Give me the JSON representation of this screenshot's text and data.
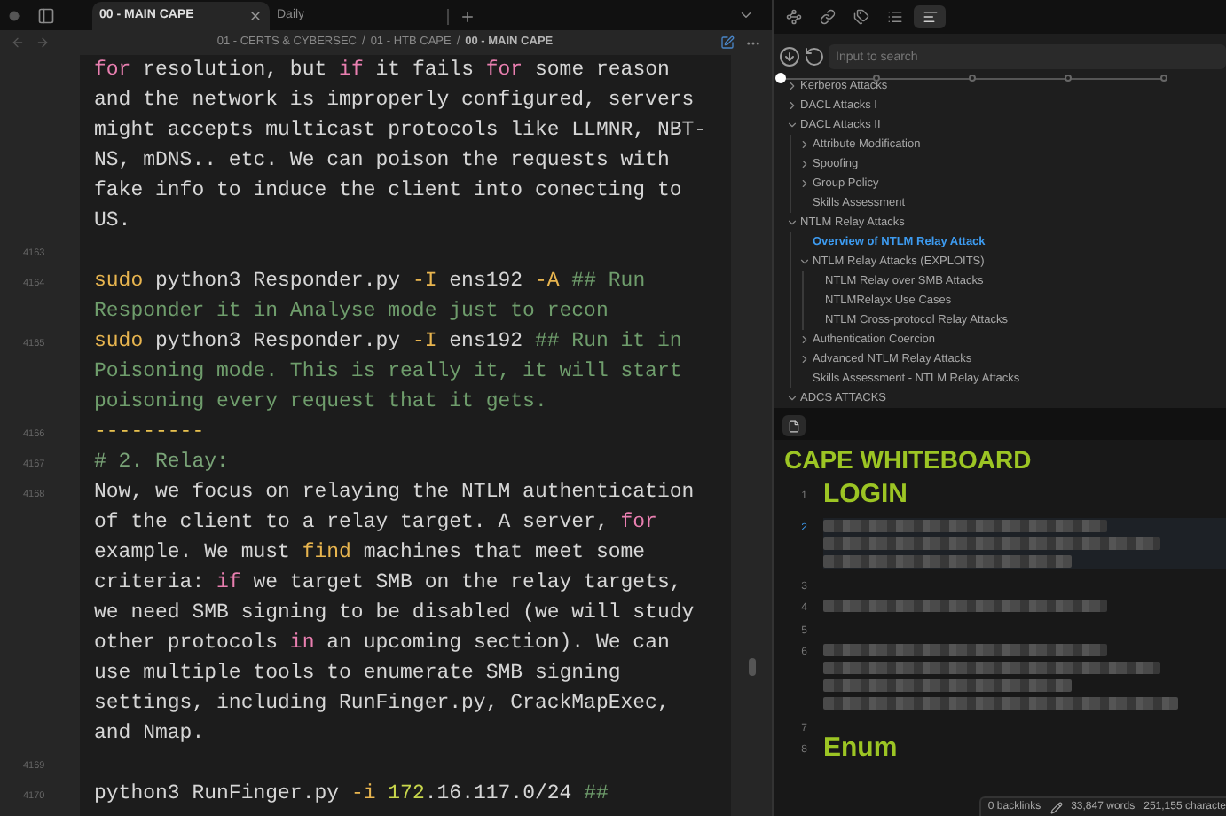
{
  "tabs": [
    {
      "label": "00 - MAIN CAPE",
      "selected": true
    },
    {
      "label": "Daily",
      "selected": false
    }
  ],
  "breadcrumb": [
    {
      "label": "01 - CERTS & CYBERSEC",
      "current": false
    },
    {
      "label": "01 - HTB CAPE",
      "current": false
    },
    {
      "label": "00 - MAIN CAPE",
      "current": true
    }
  ],
  "breadcrumb_separator": "/",
  "editor_lines": [
    {
      "segments": [
        {
          "kind": "keyword",
          "text": "for"
        },
        {
          "kind": "plain",
          "text": " resolution, but "
        },
        {
          "kind": "keyword",
          "text": "if"
        },
        {
          "kind": "plain",
          "text": " it fails "
        },
        {
          "kind": "keyword",
          "text": "for"
        },
        {
          "kind": "plain",
          "text": " some reason and the network is improperly configured, servers might accepts multicast protocols like LLMNR, NBT-NS, mDNS.. etc. We can poison the requests with fake info to induce the client into conecting to US."
        }
      ]
    },
    {
      "number": "4163"
    },
    {
      "number": "4164",
      "segments": [
        {
          "kind": "command",
          "text": "sudo"
        },
        {
          "kind": "plain",
          "text": " python3 Responder.py "
        },
        {
          "kind": "flag",
          "text": "-I"
        },
        {
          "kind": "plain",
          "text": " ens192 "
        },
        {
          "kind": "flag",
          "text": "-A"
        },
        {
          "kind": "comment",
          "text": " ## Run Responder it in Analyse mode just to recon"
        }
      ]
    },
    {
      "number": "4165",
      "segments": [
        {
          "kind": "command",
          "text": "sudo"
        },
        {
          "kind": "plain",
          "text": " python3 Responder.py "
        },
        {
          "kind": "flag",
          "text": "-I"
        },
        {
          "kind": "plain",
          "text": " ens192 "
        },
        {
          "kind": "comment",
          "text": "## Run it in Poisoning mode. This is really it, it will start poisoning every request that it gets."
        }
      ]
    },
    {
      "number": "4166",
      "segments": [
        {
          "kind": "divider",
          "text": "---------"
        }
      ]
    },
    {
      "number": "4167",
      "segments": [
        {
          "kind": "heading",
          "text": "# 2. Relay:"
        }
      ]
    },
    {
      "number": "4168",
      "segments": [
        {
          "kind": "plain",
          "text": "Now, we focus on relaying the NTLM authentication of the client to a relay target. A server, "
        },
        {
          "kind": "keyword",
          "text": "for"
        },
        {
          "kind": "plain",
          "text": " example. We must "
        },
        {
          "kind": "command",
          "text": "find"
        },
        {
          "kind": "plain",
          "text": " machines that meet some criteria: "
        },
        {
          "kind": "keyword",
          "text": "if"
        },
        {
          "kind": "plain",
          "text": " we target SMB on the relay targets, we need SMB signing to be disabled (we will study other protocols "
        },
        {
          "kind": "keyword",
          "text": "in"
        },
        {
          "kind": "plain",
          "text": " an upcoming section). We can use multiple tools to enumerate SMB signing settings, including RunFinger.py, CrackMapExec, and Nmap."
        }
      ]
    },
    {
      "number": "4169"
    },
    {
      "number": "4170",
      "segments": [
        {
          "kind": "plain",
          "text": "python3 RunFinger.py "
        },
        {
          "kind": "flag",
          "text": "-i"
        },
        {
          "kind": "number",
          "text": " 172"
        },
        {
          "kind": "plain",
          "text": ".16.117.0/24 "
        },
        {
          "kind": "comment",
          "text": "##"
        }
      ]
    }
  ],
  "outline": {
    "search": {
      "placeholder": "Input to search"
    },
    "heading_slider": {
      "level": 0
    },
    "items": [
      {
        "label": "Kerberos Attacks",
        "expanded": false,
        "selected": false
      },
      {
        "label": "DACL Attacks I",
        "expanded": false,
        "selected": false
      },
      {
        "label": "DACL Attacks II",
        "expanded": true,
        "selected": false,
        "children": [
          {
            "label": "Attribute Modification",
            "expanded": false,
            "selected": false
          },
          {
            "label": "Spoofing",
            "expanded": false,
            "selected": false
          },
          {
            "label": "Group Policy",
            "expanded": false,
            "selected": false
          },
          {
            "label": "Skills Assessment",
            "selected": false
          }
        ]
      },
      {
        "label": "NTLM Relay Attacks",
        "expanded": true,
        "selected": false,
        "children": [
          {
            "label": "Overview of NTLM Relay Attack",
            "selected": true
          },
          {
            "label": "NTLM Relay Attacks (EXPLOITS)",
            "expanded": true,
            "selected": false,
            "children": [
              {
                "label": "NTLM Relay over SMB Attacks",
                "selected": false
              },
              {
                "label": "NTLMRelayx Use Cases",
                "selected": false
              },
              {
                "label": "NTLM Cross-protocol Relay Attacks",
                "selected": false
              }
            ]
          },
          {
            "label": "Authentication Coercion",
            "expanded": false,
            "selected": false
          },
          {
            "label": "Advanced NTLM Relay Attacks",
            "expanded": false,
            "selected": false
          },
          {
            "label": "Skills Assessment - NTLM Relay Attacks",
            "selected": false
          }
        ]
      },
      {
        "label": "ADCS ATTACKS",
        "expanded": true,
        "selected": false
      }
    ]
  },
  "whiteboard": {
    "title": "CAPE WHITEBOARD",
    "lines": [
      {
        "number": "1",
        "kind": "heading",
        "text": "LOGIN",
        "current": false
      },
      {
        "number": "2",
        "kind": "redacted_paragraph",
        "current": true
      },
      {
        "number": "3",
        "kind": "blank",
        "current": false
      },
      {
        "number": "4",
        "kind": "redacted_line",
        "current": false
      },
      {
        "number": "5",
        "kind": "blank",
        "current": false
      },
      {
        "number": "6",
        "kind": "redacted_block",
        "current": false
      },
      {
        "number": "7",
        "kind": "blank",
        "current": false
      },
      {
        "number": "8",
        "kind": "heading",
        "text": "Enum",
        "current": false
      }
    ]
  },
  "status_bar": {
    "backlinks": "0 backlinks",
    "words": "33,847 words",
    "characters": "251,155 characte"
  }
}
